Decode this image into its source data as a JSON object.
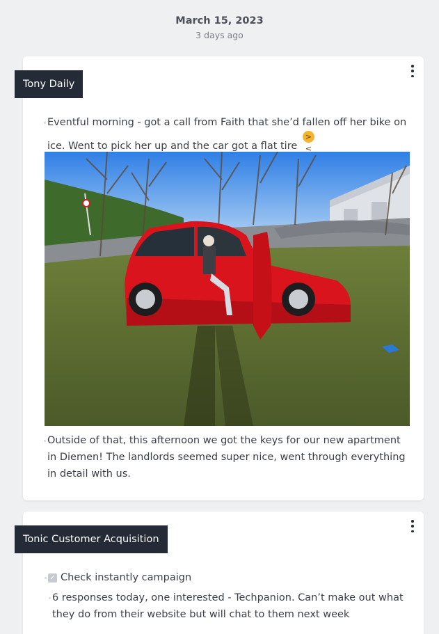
{
  "date_group": {
    "title": "March 15, 2023",
    "relative": "3 days ago"
  },
  "entries": [
    {
      "page": "Tony Daily",
      "blocks": [
        {
          "text": "Eventful morning - got a call from Faith that she’d fallen off her bike on ice. Went to pick her up and the car got a flat tire",
          "emoji": "😩"
        },
        {
          "image": "red-car-photo"
        },
        {
          "text": "Outside of that, this afternoon we got the keys for our new apartment in Diemen! The landlords seemed super nice, went through everything in detail with us."
        }
      ]
    },
    {
      "page": "Tonic Customer Acquisition",
      "todo": {
        "label": "Check instantly campaign",
        "checked": true
      },
      "blocks": [
        {
          "text": "6 responses today, one interested - Techpanion. Can’t make out what they do from their website but will chat to them next week"
        }
      ]
    }
  ],
  "icons": {
    "menu": "kebab-menu-icon",
    "checkbox": "checkbox-icon"
  },
  "colors": {
    "background": "#eff0f2",
    "card": "#ffffff",
    "tag": "#242b37",
    "tag_text": "#ffffff"
  }
}
